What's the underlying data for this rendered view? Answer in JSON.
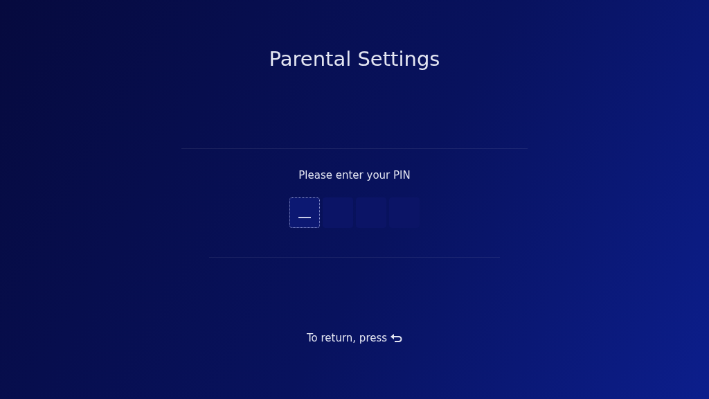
{
  "title": "Parental Settings",
  "prompt": "Please enter your PIN",
  "pin_boxes": [
    {
      "selected": true
    },
    {
      "selected": false
    },
    {
      "selected": false
    },
    {
      "selected": false
    }
  ],
  "footer": "To return, press"
}
